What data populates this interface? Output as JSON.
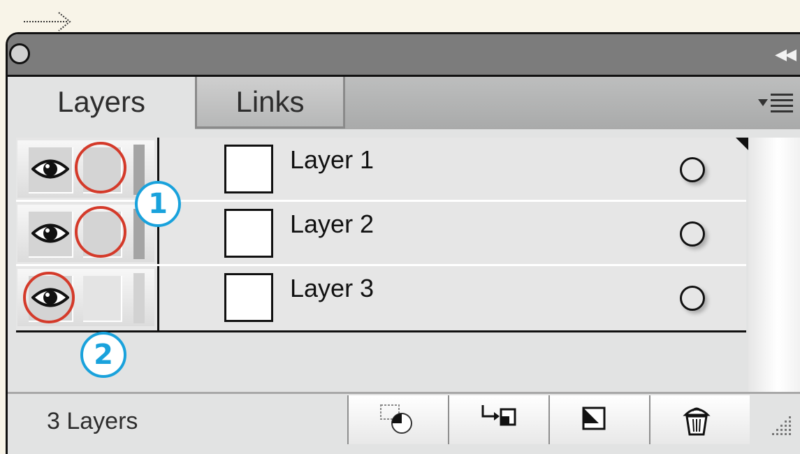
{
  "panel": {
    "tabs": [
      {
        "label": "Layers",
        "active": true
      },
      {
        "label": "Links",
        "active": false
      }
    ]
  },
  "layers": [
    {
      "name": "Layer 1",
      "visible": true
    },
    {
      "name": "Layer 2",
      "visible": true
    },
    {
      "name": "Layer 3",
      "visible": true
    }
  ],
  "callouts": [
    "1",
    "2"
  ],
  "status": {
    "count_text": "3 Layers"
  },
  "icons": {
    "collapse": "double-left-arrow",
    "menu": "panel-menu-icon",
    "footer": [
      "new-sublayer",
      "create-new-layer-from-selection",
      "new-layer",
      "delete-layer"
    ]
  },
  "colors": {
    "callout": "#19a2dc",
    "highlight_ring": "#d43a2a"
  }
}
